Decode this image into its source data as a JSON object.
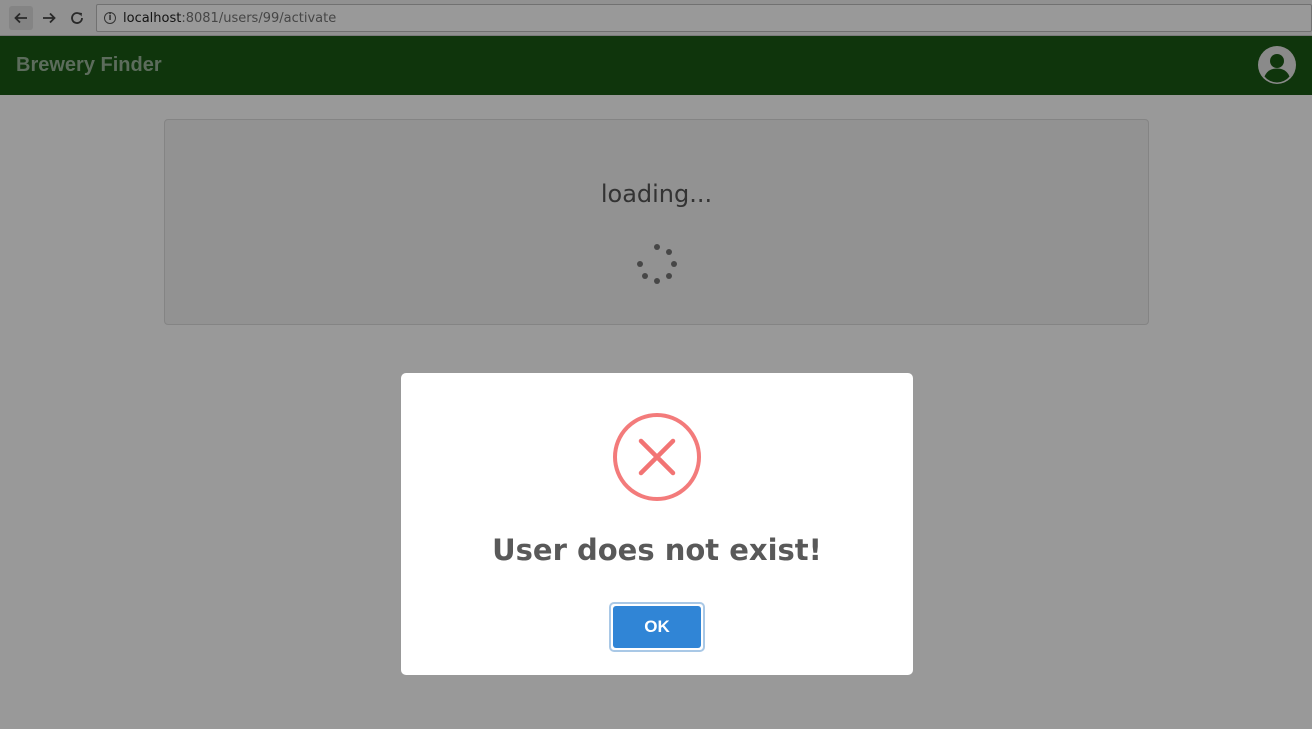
{
  "browser": {
    "url_host": "localhost",
    "url_rest": ":8081/users/99/activate",
    "info_symbol": "i"
  },
  "header": {
    "brand": "Brewery Finder",
    "avatar_icon": "user-circle-icon",
    "background_color": "#1a5914"
  },
  "main": {
    "loading_text": "loading...",
    "spinner_icon": "spinner-icon"
  },
  "modal": {
    "icon": "error-x-icon",
    "icon_color": "#f27474",
    "title": "User does not exist!",
    "ok_label": "OK",
    "button_color": "#3085d6"
  }
}
